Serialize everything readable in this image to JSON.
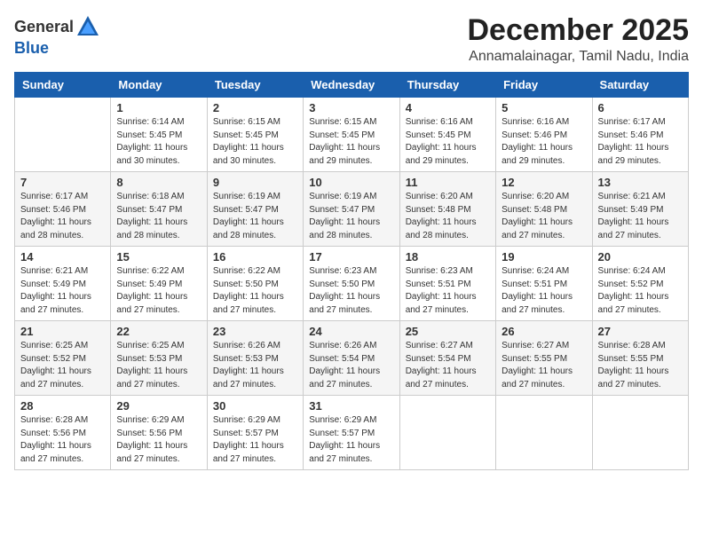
{
  "logo": {
    "general": "General",
    "blue": "Blue"
  },
  "header": {
    "month": "December 2025",
    "location": "Annamalainagar, Tamil Nadu, India"
  },
  "weekdays": [
    "Sunday",
    "Monday",
    "Tuesday",
    "Wednesday",
    "Thursday",
    "Friday",
    "Saturday"
  ],
  "weeks": [
    [
      {
        "day": "",
        "info": ""
      },
      {
        "day": "1",
        "info": "Sunrise: 6:14 AM\nSunset: 5:45 PM\nDaylight: 11 hours\nand 30 minutes."
      },
      {
        "day": "2",
        "info": "Sunrise: 6:15 AM\nSunset: 5:45 PM\nDaylight: 11 hours\nand 30 minutes."
      },
      {
        "day": "3",
        "info": "Sunrise: 6:15 AM\nSunset: 5:45 PM\nDaylight: 11 hours\nand 29 minutes."
      },
      {
        "day": "4",
        "info": "Sunrise: 6:16 AM\nSunset: 5:45 PM\nDaylight: 11 hours\nand 29 minutes."
      },
      {
        "day": "5",
        "info": "Sunrise: 6:16 AM\nSunset: 5:46 PM\nDaylight: 11 hours\nand 29 minutes."
      },
      {
        "day": "6",
        "info": "Sunrise: 6:17 AM\nSunset: 5:46 PM\nDaylight: 11 hours\nand 29 minutes."
      }
    ],
    [
      {
        "day": "7",
        "info": "Sunrise: 6:17 AM\nSunset: 5:46 PM\nDaylight: 11 hours\nand 28 minutes."
      },
      {
        "day": "8",
        "info": "Sunrise: 6:18 AM\nSunset: 5:47 PM\nDaylight: 11 hours\nand 28 minutes."
      },
      {
        "day": "9",
        "info": "Sunrise: 6:19 AM\nSunset: 5:47 PM\nDaylight: 11 hours\nand 28 minutes."
      },
      {
        "day": "10",
        "info": "Sunrise: 6:19 AM\nSunset: 5:47 PM\nDaylight: 11 hours\nand 28 minutes."
      },
      {
        "day": "11",
        "info": "Sunrise: 6:20 AM\nSunset: 5:48 PM\nDaylight: 11 hours\nand 28 minutes."
      },
      {
        "day": "12",
        "info": "Sunrise: 6:20 AM\nSunset: 5:48 PM\nDaylight: 11 hours\nand 27 minutes."
      },
      {
        "day": "13",
        "info": "Sunrise: 6:21 AM\nSunset: 5:49 PM\nDaylight: 11 hours\nand 27 minutes."
      }
    ],
    [
      {
        "day": "14",
        "info": "Sunrise: 6:21 AM\nSunset: 5:49 PM\nDaylight: 11 hours\nand 27 minutes."
      },
      {
        "day": "15",
        "info": "Sunrise: 6:22 AM\nSunset: 5:49 PM\nDaylight: 11 hours\nand 27 minutes."
      },
      {
        "day": "16",
        "info": "Sunrise: 6:22 AM\nSunset: 5:50 PM\nDaylight: 11 hours\nand 27 minutes."
      },
      {
        "day": "17",
        "info": "Sunrise: 6:23 AM\nSunset: 5:50 PM\nDaylight: 11 hours\nand 27 minutes."
      },
      {
        "day": "18",
        "info": "Sunrise: 6:23 AM\nSunset: 5:51 PM\nDaylight: 11 hours\nand 27 minutes."
      },
      {
        "day": "19",
        "info": "Sunrise: 6:24 AM\nSunset: 5:51 PM\nDaylight: 11 hours\nand 27 minutes."
      },
      {
        "day": "20",
        "info": "Sunrise: 6:24 AM\nSunset: 5:52 PM\nDaylight: 11 hours\nand 27 minutes."
      }
    ],
    [
      {
        "day": "21",
        "info": "Sunrise: 6:25 AM\nSunset: 5:52 PM\nDaylight: 11 hours\nand 27 minutes."
      },
      {
        "day": "22",
        "info": "Sunrise: 6:25 AM\nSunset: 5:53 PM\nDaylight: 11 hours\nand 27 minutes."
      },
      {
        "day": "23",
        "info": "Sunrise: 6:26 AM\nSunset: 5:53 PM\nDaylight: 11 hours\nand 27 minutes."
      },
      {
        "day": "24",
        "info": "Sunrise: 6:26 AM\nSunset: 5:54 PM\nDaylight: 11 hours\nand 27 minutes."
      },
      {
        "day": "25",
        "info": "Sunrise: 6:27 AM\nSunset: 5:54 PM\nDaylight: 11 hours\nand 27 minutes."
      },
      {
        "day": "26",
        "info": "Sunrise: 6:27 AM\nSunset: 5:55 PM\nDaylight: 11 hours\nand 27 minutes."
      },
      {
        "day": "27",
        "info": "Sunrise: 6:28 AM\nSunset: 5:55 PM\nDaylight: 11 hours\nand 27 minutes."
      }
    ],
    [
      {
        "day": "28",
        "info": "Sunrise: 6:28 AM\nSunset: 5:56 PM\nDaylight: 11 hours\nand 27 minutes."
      },
      {
        "day": "29",
        "info": "Sunrise: 6:29 AM\nSunset: 5:56 PM\nDaylight: 11 hours\nand 27 minutes."
      },
      {
        "day": "30",
        "info": "Sunrise: 6:29 AM\nSunset: 5:57 PM\nDaylight: 11 hours\nand 27 minutes."
      },
      {
        "day": "31",
        "info": "Sunrise: 6:29 AM\nSunset: 5:57 PM\nDaylight: 11 hours\nand 27 minutes."
      },
      {
        "day": "",
        "info": ""
      },
      {
        "day": "",
        "info": ""
      },
      {
        "day": "",
        "info": ""
      }
    ]
  ]
}
